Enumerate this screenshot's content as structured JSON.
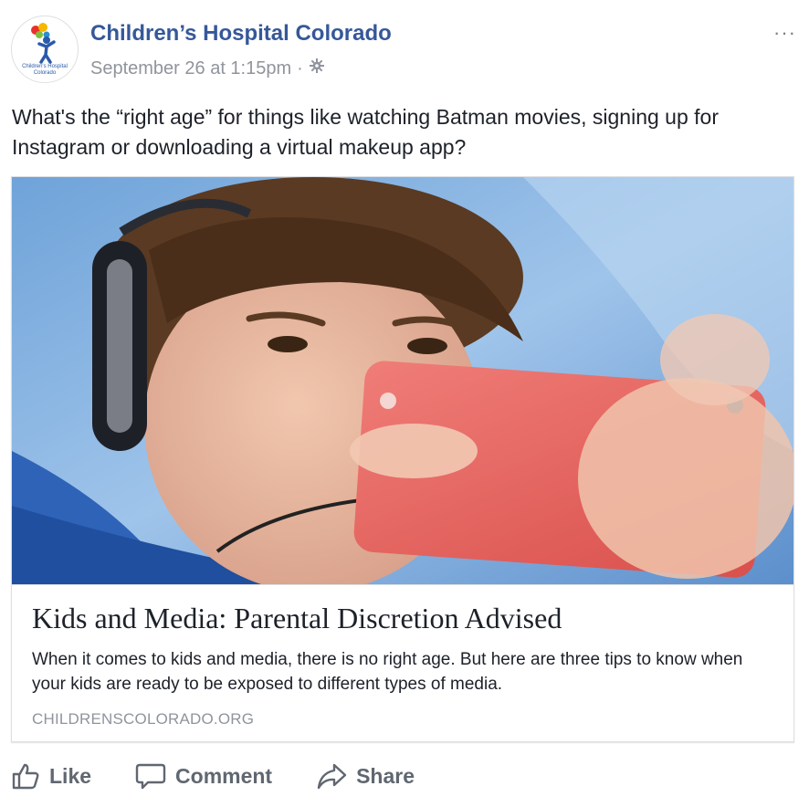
{
  "page": {
    "name": "Children’s Hospital Colorado",
    "avatar_text": "Children's Hospital Colorado",
    "timestamp": "September 26 at 1:15pm",
    "separator": "·",
    "privacy_icon": "gear-icon",
    "options_label": "···"
  },
  "post": {
    "text": "What's the “right age” for things like watching Batman movies, signing up for Instagram or downloading a virtual makeup app?"
  },
  "link": {
    "image_description": "boy with headphones looking at phone",
    "title": "Kids and Media: Parental Discretion Advised",
    "description": "When it comes to kids and media, there is no right age. But here are three tips to know when your kids are ready to be exposed to different types of media.",
    "domain": "CHILDRENSCOLORADO.ORG"
  },
  "actions": {
    "like": "Like",
    "comment": "Comment",
    "share": "Share"
  },
  "colors": {
    "page_name": "#365899",
    "meta": "#90949c",
    "text": "#1d2129",
    "action": "#606770"
  }
}
